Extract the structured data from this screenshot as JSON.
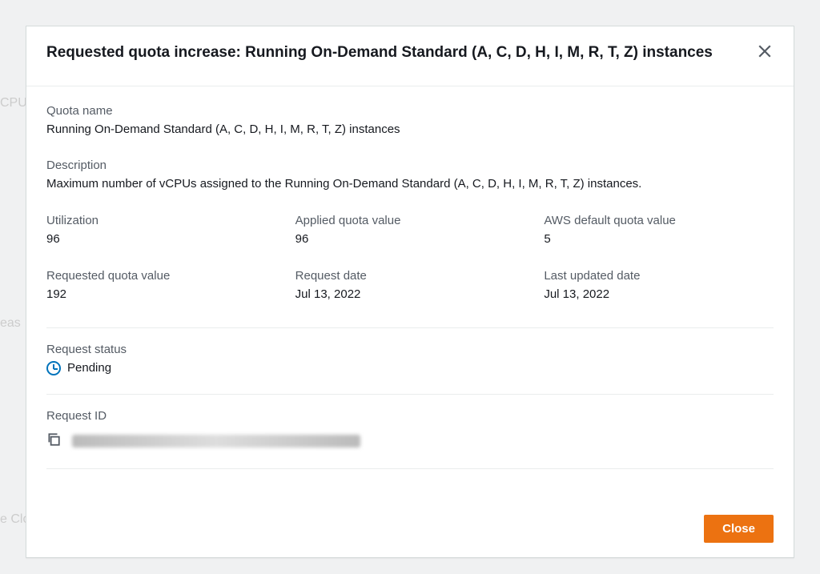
{
  "modal": {
    "title": "Requested quota increase: Running On-Demand Standard (A, C, D, H, I, M, R, T, Z) instances",
    "close_label": "Close"
  },
  "fields": {
    "quota_name": {
      "label": "Quota name",
      "value": "Running On-Demand Standard (A, C, D, H, I, M, R, T, Z) instances"
    },
    "description": {
      "label": "Description",
      "value": "Maximum number of vCPUs assigned to the Running On-Demand Standard (A, C, D, H, I, M, R, T, Z) instances."
    },
    "utilization": {
      "label": "Utilization",
      "value": "96"
    },
    "applied_quota": {
      "label": "Applied quota value",
      "value": "96"
    },
    "default_quota": {
      "label": "AWS default quota value",
      "value": "5"
    },
    "requested_quota": {
      "label": "Requested quota value",
      "value": "192"
    },
    "request_date": {
      "label": "Request date",
      "value": "Jul 13, 2022"
    },
    "last_updated": {
      "label": "Last updated date",
      "value": "Jul 13, 2022"
    },
    "request_status": {
      "label": "Request status",
      "value": "Pending"
    },
    "request_id": {
      "label": "Request ID"
    }
  },
  "background": {
    "text1": "CPUs",
    "text2": "eas",
    "text3": "e Clo"
  }
}
